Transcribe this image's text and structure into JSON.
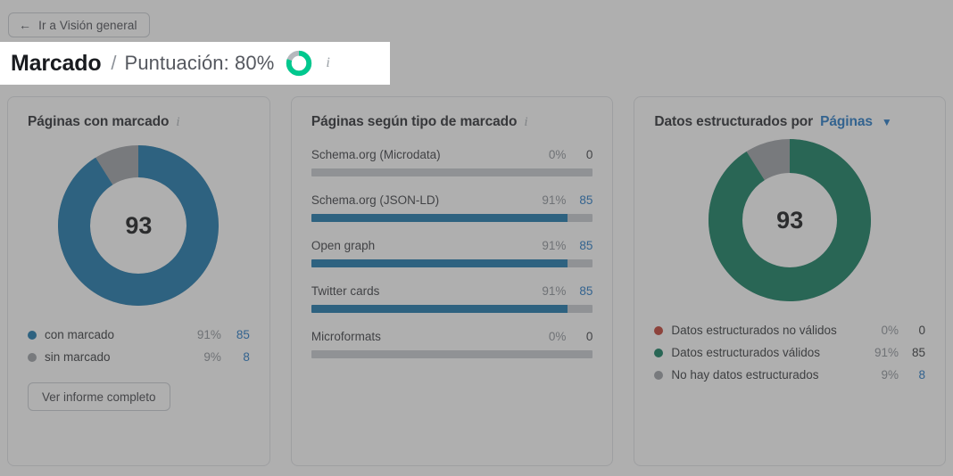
{
  "nav": {
    "back_label": "Ir a Visión general",
    "back_icon": "arrow-left-icon"
  },
  "header": {
    "title": "Marcado",
    "separator": "/",
    "score_label": "Puntuación: 80%",
    "score_value": 80,
    "score_ring_color": "#00c88e",
    "score_ring_track": "#b5b8bd",
    "info_icon": "info-icon"
  },
  "colors": {
    "blue": "#1271a8",
    "gray": "#9a9ea3",
    "green": "#08785a",
    "red": "#c0392b",
    "link": "#1a73c4"
  },
  "cards": [
    {
      "id": "paginas-con-marcado",
      "title": "Páginas con marcado",
      "info_icon": "info-icon",
      "chart_center": "93",
      "legend": [
        {
          "label": "con marcado",
          "pct": "91%",
          "value": "85",
          "color": "#1271a8",
          "value_is_link": true
        },
        {
          "label": "sin marcado",
          "pct": "9%",
          "value": "8",
          "color": "#9a9ea3",
          "value_is_link": true
        }
      ],
      "button_label": "Ver informe completo"
    },
    {
      "id": "paginas-segun-tipo-de-marcado",
      "title": "Páginas según tipo de marcado",
      "info_icon": "info-icon",
      "bars": [
        {
          "name": "Schema.org (Microdata)",
          "pct": "0%",
          "value": "0",
          "fill": 0,
          "value_is_link": false
        },
        {
          "name": "Schema.org (JSON-LD)",
          "pct": "91%",
          "value": "85",
          "fill": 91,
          "value_is_link": true
        },
        {
          "name": "Open graph",
          "pct": "91%",
          "value": "85",
          "fill": 91,
          "value_is_link": true
        },
        {
          "name": "Twitter cards",
          "pct": "91%",
          "value": "85",
          "fill": 91,
          "value_is_link": true
        },
        {
          "name": "Microformats",
          "pct": "0%",
          "value": "0",
          "fill": 0,
          "value_is_link": false
        }
      ]
    },
    {
      "id": "datos-estructurados-por-paginas",
      "title_prefix": "Datos estructurados por",
      "title_link": "Páginas",
      "chevron_icon": "chevron-down-icon",
      "chart_center": "93",
      "legend": [
        {
          "label": "Datos estructurados no válidos",
          "pct": "0%",
          "value": "0",
          "color": "#c0392b",
          "value_is_link": false
        },
        {
          "label": "Datos estructurados válidos",
          "pct": "91%",
          "value": "85",
          "color": "#08785a",
          "value_is_link": false
        },
        {
          "label": "No hay datos estructurados",
          "pct": "9%",
          "value": "8",
          "color": "#9a9ea3",
          "value_is_link": true
        }
      ]
    }
  ],
  "chart_data": [
    {
      "type": "pie",
      "title": "Páginas con marcado",
      "total": 93,
      "categories": [
        "con marcado",
        "sin marcado"
      ],
      "values": [
        85,
        8
      ],
      "percentages": [
        91,
        9
      ],
      "colors": [
        "#1271a8",
        "#9a9ea3"
      ],
      "legend_position": "bottom",
      "donut": true
    },
    {
      "type": "bar",
      "title": "Páginas según tipo de marcado",
      "orientation": "horizontal",
      "categories": [
        "Schema.org (Microdata)",
        "Schema.org (JSON-LD)",
        "Open graph",
        "Twitter cards",
        "Microformats"
      ],
      "values": [
        0,
        85,
        85,
        85,
        0
      ],
      "percentages": [
        0,
        91,
        91,
        91,
        0
      ],
      "xlabel": "",
      "ylabel": "",
      "xlim": [
        0,
        100
      ],
      "grid": false,
      "color": "#1271a8"
    },
    {
      "type": "pie",
      "title": "Datos estructurados por Páginas",
      "total": 93,
      "categories": [
        "Datos estructurados no válidos",
        "Datos estructurados válidos",
        "No hay datos estructurados"
      ],
      "values": [
        0,
        85,
        8
      ],
      "percentages": [
        0,
        91,
        9
      ],
      "colors": [
        "#c0392b",
        "#08785a",
        "#9a9ea3"
      ],
      "legend_position": "bottom",
      "donut": true
    },
    {
      "type": "pie",
      "title": "Puntuación",
      "total": 100,
      "categories": [
        "score",
        "remaining"
      ],
      "values": [
        80,
        20
      ],
      "percentages": [
        80,
        20
      ],
      "colors": [
        "#00c88e",
        "#b5b8bd"
      ],
      "donut": true
    }
  ]
}
